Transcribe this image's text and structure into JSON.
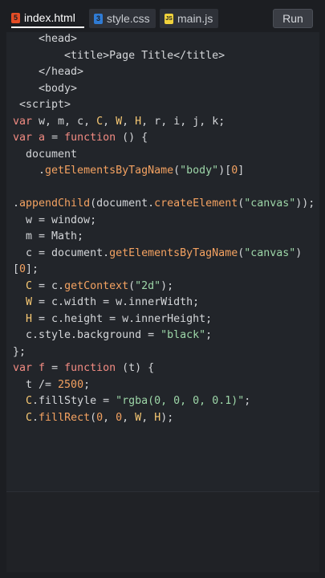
{
  "tabs": [
    {
      "label": "index.html",
      "icon": "html5-icon",
      "active": true
    },
    {
      "label": "style.css",
      "icon": "css3-icon",
      "active": false
    },
    {
      "label": "main.js",
      "icon": "js-icon",
      "active": false
    }
  ],
  "run_label": "Run",
  "code_lines": [
    [
      {
        "t": "    <head>",
        "c": "plain"
      }
    ],
    [
      {
        "t": "        <title>Page Title</title>",
        "c": "plain"
      }
    ],
    [
      {
        "t": "    </head>",
        "c": "plain"
      }
    ],
    [
      {
        "t": "    <body>",
        "c": "plain"
      }
    ],
    [
      {
        "t": " <script>",
        "c": "plain"
      }
    ],
    [
      {
        "t": "var",
        "c": "kw"
      },
      {
        "t": " w, m, c, ",
        "c": "plain"
      },
      {
        "t": "C",
        "c": "cap"
      },
      {
        "t": ", ",
        "c": "plain"
      },
      {
        "t": "W",
        "c": "cap"
      },
      {
        "t": ", ",
        "c": "plain"
      },
      {
        "t": "H",
        "c": "cap"
      },
      {
        "t": ", r, i, j, k;",
        "c": "plain"
      }
    ],
    [
      {
        "t": "var",
        "c": "kw"
      },
      {
        "t": " ",
        "c": "plain"
      },
      {
        "t": "a",
        "c": "kw"
      },
      {
        "t": " = ",
        "c": "plain"
      },
      {
        "t": "function",
        "c": "kw"
      },
      {
        "t": " () {",
        "c": "plain"
      }
    ],
    [
      {
        "t": "  document",
        "c": "plain"
      }
    ],
    [
      {
        "t": "    .",
        "c": "plain"
      },
      {
        "t": "getElementsByTagName",
        "c": "fn"
      },
      {
        "t": "(",
        "c": "plain"
      },
      {
        "t": "\"body\"",
        "c": "str"
      },
      {
        "t": ")[",
        "c": "plain"
      },
      {
        "t": "0",
        "c": "num"
      },
      {
        "t": "]",
        "c": "plain"
      }
    ],
    [
      {
        "t": "",
        "c": "plain"
      }
    ],
    [
      {
        "t": ".",
        "c": "plain"
      },
      {
        "t": "appendChild",
        "c": "fn"
      },
      {
        "t": "(document.",
        "c": "plain"
      },
      {
        "t": "createElement",
        "c": "fn"
      },
      {
        "t": "(",
        "c": "plain"
      },
      {
        "t": "\"canvas\"",
        "c": "str"
      },
      {
        "t": "));",
        "c": "plain"
      }
    ],
    [
      {
        "t": "  w = window;",
        "c": "plain"
      }
    ],
    [
      {
        "t": "  m = Math;",
        "c": "plain"
      }
    ],
    [
      {
        "t": "  c = document.",
        "c": "plain"
      },
      {
        "t": "getElementsByTagName",
        "c": "fn"
      },
      {
        "t": "(",
        "c": "plain"
      },
      {
        "t": "\"canvas\"",
        "c": "str"
      },
      {
        "t": ")",
        "c": "plain"
      }
    ],
    [
      {
        "t": "[",
        "c": "plain"
      },
      {
        "t": "0",
        "c": "num"
      },
      {
        "t": "];",
        "c": "plain"
      }
    ],
    [
      {
        "t": "  ",
        "c": "plain"
      },
      {
        "t": "C",
        "c": "cap"
      },
      {
        "t": " = c.",
        "c": "plain"
      },
      {
        "t": "getContext",
        "c": "fn"
      },
      {
        "t": "(",
        "c": "plain"
      },
      {
        "t": "\"2d\"",
        "c": "str"
      },
      {
        "t": ");",
        "c": "plain"
      }
    ],
    [
      {
        "t": "  ",
        "c": "plain"
      },
      {
        "t": "W",
        "c": "cap"
      },
      {
        "t": " = c.width = w.innerWidth;",
        "c": "plain"
      }
    ],
    [
      {
        "t": "  ",
        "c": "plain"
      },
      {
        "t": "H",
        "c": "cap"
      },
      {
        "t": " = c.height = w.innerHeight;",
        "c": "plain"
      }
    ],
    [
      {
        "t": "  c.style.background = ",
        "c": "plain"
      },
      {
        "t": "\"black\"",
        "c": "str"
      },
      {
        "t": ";",
        "c": "plain"
      }
    ],
    [
      {
        "t": "};",
        "c": "plain"
      }
    ],
    [
      {
        "t": "var",
        "c": "kw"
      },
      {
        "t": " ",
        "c": "plain"
      },
      {
        "t": "f",
        "c": "kw"
      },
      {
        "t": " = ",
        "c": "plain"
      },
      {
        "t": "function",
        "c": "kw"
      },
      {
        "t": " (t) {",
        "c": "plain"
      }
    ],
    [
      {
        "t": "  t /= ",
        "c": "plain"
      },
      {
        "t": "2500",
        "c": "num"
      },
      {
        "t": ";",
        "c": "plain"
      }
    ],
    [
      {
        "t": "  ",
        "c": "plain"
      },
      {
        "t": "C",
        "c": "cap"
      },
      {
        "t": ".fillStyle = ",
        "c": "plain"
      },
      {
        "t": "\"rgba(0, 0, 0, 0.1)\"",
        "c": "str"
      },
      {
        "t": ";",
        "c": "plain"
      }
    ],
    [
      {
        "t": "  ",
        "c": "plain"
      },
      {
        "t": "C",
        "c": "cap"
      },
      {
        "t": ".",
        "c": "plain"
      },
      {
        "t": "fillRect",
        "c": "fn"
      },
      {
        "t": "(",
        "c": "plain"
      },
      {
        "t": "0",
        "c": "num"
      },
      {
        "t": ", ",
        "c": "plain"
      },
      {
        "t": "0",
        "c": "num"
      },
      {
        "t": ", ",
        "c": "plain"
      },
      {
        "t": "W",
        "c": "cap"
      },
      {
        "t": ", ",
        "c": "plain"
      },
      {
        "t": "H",
        "c": "cap"
      },
      {
        "t": ");",
        "c": "plain"
      }
    ]
  ]
}
